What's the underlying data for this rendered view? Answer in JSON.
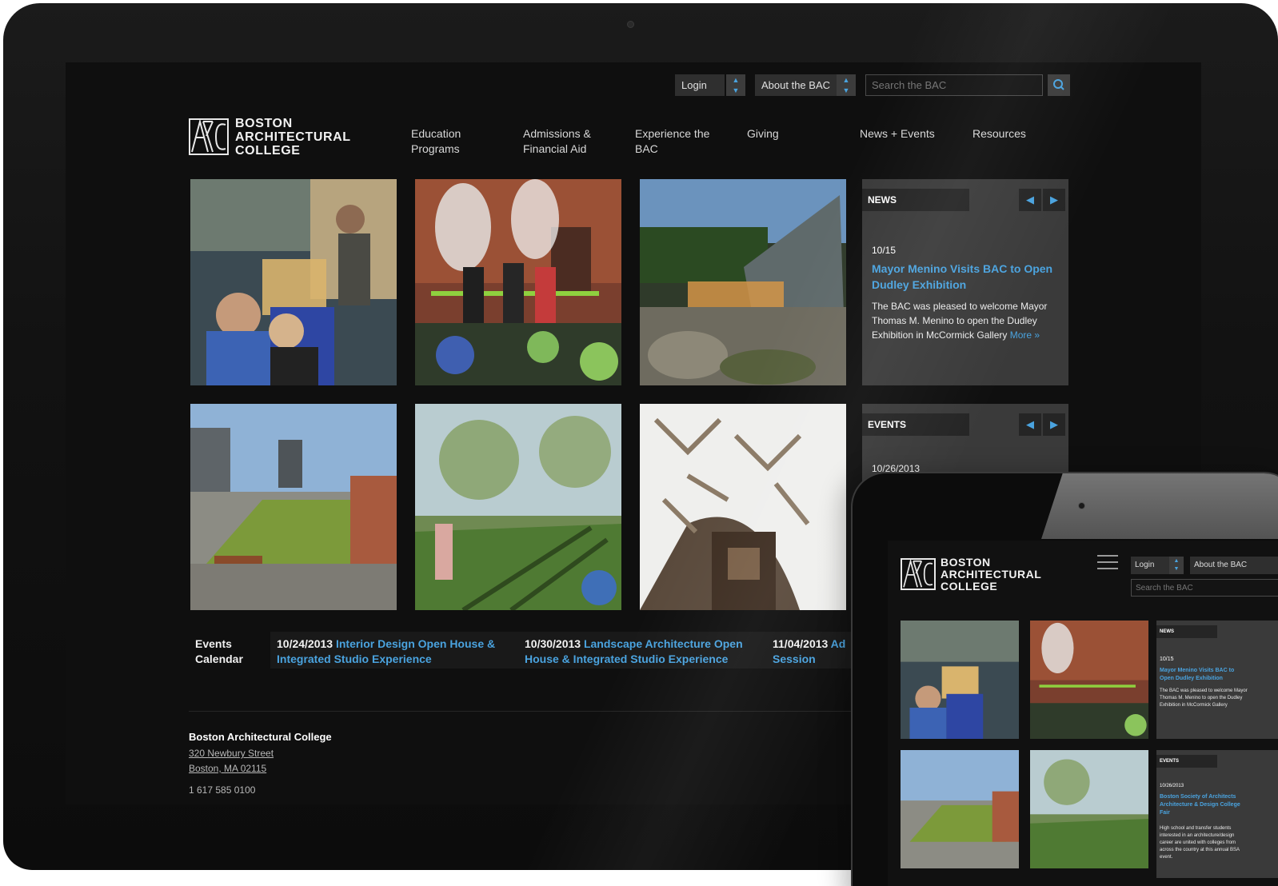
{
  "utility": {
    "login_label": "Login",
    "about_label": "About the BAC",
    "search_placeholder": "Search the BAC"
  },
  "logo": {
    "line1": "BOSTON",
    "line2": "ARCHITECTURAL",
    "line3": "COLLEGE"
  },
  "nav": {
    "items": [
      {
        "label": "Education\nPrograms"
      },
      {
        "label": "Admissions &\nFinancial Aid"
      },
      {
        "label": "Experience the\nBAC"
      },
      {
        "label": "Giving"
      },
      {
        "label": "News + Events"
      },
      {
        "label": "Resources"
      }
    ]
  },
  "news": {
    "heading": "NEWS",
    "date": "10/15",
    "title": "Mayor Menino Visits BAC to Open Dudley Exhibition",
    "body": "The BAC was pleased to welcome Mayor Thomas M. Menino to open the Dudley Exhibition in McCormick Gallery",
    "more_label": "More »"
  },
  "events": {
    "heading": "EVENTS",
    "date": "10/26/2013"
  },
  "calendar": {
    "label": "Events\nCalendar",
    "items": [
      {
        "date": "10/24/2013",
        "title": "Interior Design Open House & Integrated Studio Experience"
      },
      {
        "date": "10/30/2013",
        "title": "Landscape Architecture Open House & Integrated Studio Experience"
      },
      {
        "date": "11/04/2013",
        "title": "Ad Session"
      }
    ]
  },
  "footer": {
    "name": "Boston Architectural College",
    "street": "320 Newbury Street",
    "city": "Boston, MA 02115",
    "phone": "1 617 585 0100"
  },
  "tablet": {
    "login_label": "Login",
    "about_label": "About the BAC",
    "search_placeholder": "Search the BAC",
    "news_heading": "NEWS",
    "news_date": "10/15",
    "news_title": "Mayor Menino Visits BAC to Open Dudley Exhibition",
    "news_body": "The BAC was pleased to welcome Mayor Thomas M. Menino to open the Dudley Exhibition in McCormick Gallery",
    "events_heading": "EVENTS",
    "events_date": "10/26/2013",
    "events_title": "Boston Society of Architects Architecture & Design College Fair",
    "events_body": "High school and transfer students interested in an architecture/design career are united with colleges from across the country at this annual BSA event."
  },
  "colors": {
    "accent": "#4aa3df",
    "screen_bg": "#0f0f0f",
    "panel_bg": "#3a3a3a"
  }
}
